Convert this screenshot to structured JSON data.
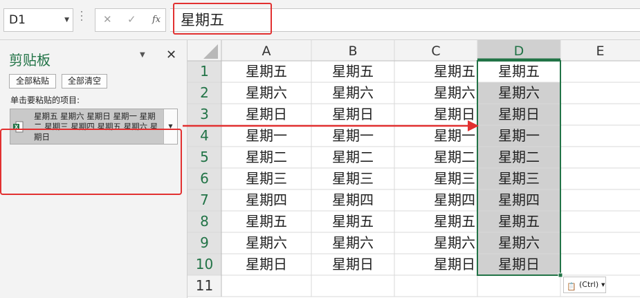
{
  "formula_bar": {
    "name_box": "D1",
    "name_box_dropdown_icon": "chevron-down-icon",
    "cancel_icon": "close-icon",
    "enter_icon": "check-icon",
    "function_label": "fx",
    "formula": "星期五",
    "highlight_color": "#e23030"
  },
  "clipboard_pane": {
    "title": "剪贴板",
    "close": "✕",
    "paste_all": "全部粘贴",
    "clear_all": "全部清空",
    "instruction": "单击要粘贴的项目:",
    "item_text": "星期五 星期六 星期日 星期一 星期二 星期三 星期四 星期五 星期六 星期日",
    "item_icon": "excel-file-icon"
  },
  "sheet": {
    "columns": [
      "A",
      "B",
      "C",
      "D",
      "E"
    ],
    "rows": [
      "1",
      "2",
      "3",
      "4",
      "5",
      "6",
      "7",
      "8",
      "9",
      "10",
      "11"
    ],
    "values": [
      "星期五",
      "星期六",
      "星期日",
      "星期一",
      "星期二",
      "星期三",
      "星期四",
      "星期五",
      "星期六",
      "星期日"
    ],
    "selected_column": "D",
    "selection_color": "#d0d0d0",
    "accent": "#217346"
  },
  "paste_options": {
    "label": "(Ctrl)",
    "icon": "clipboard-icon"
  }
}
